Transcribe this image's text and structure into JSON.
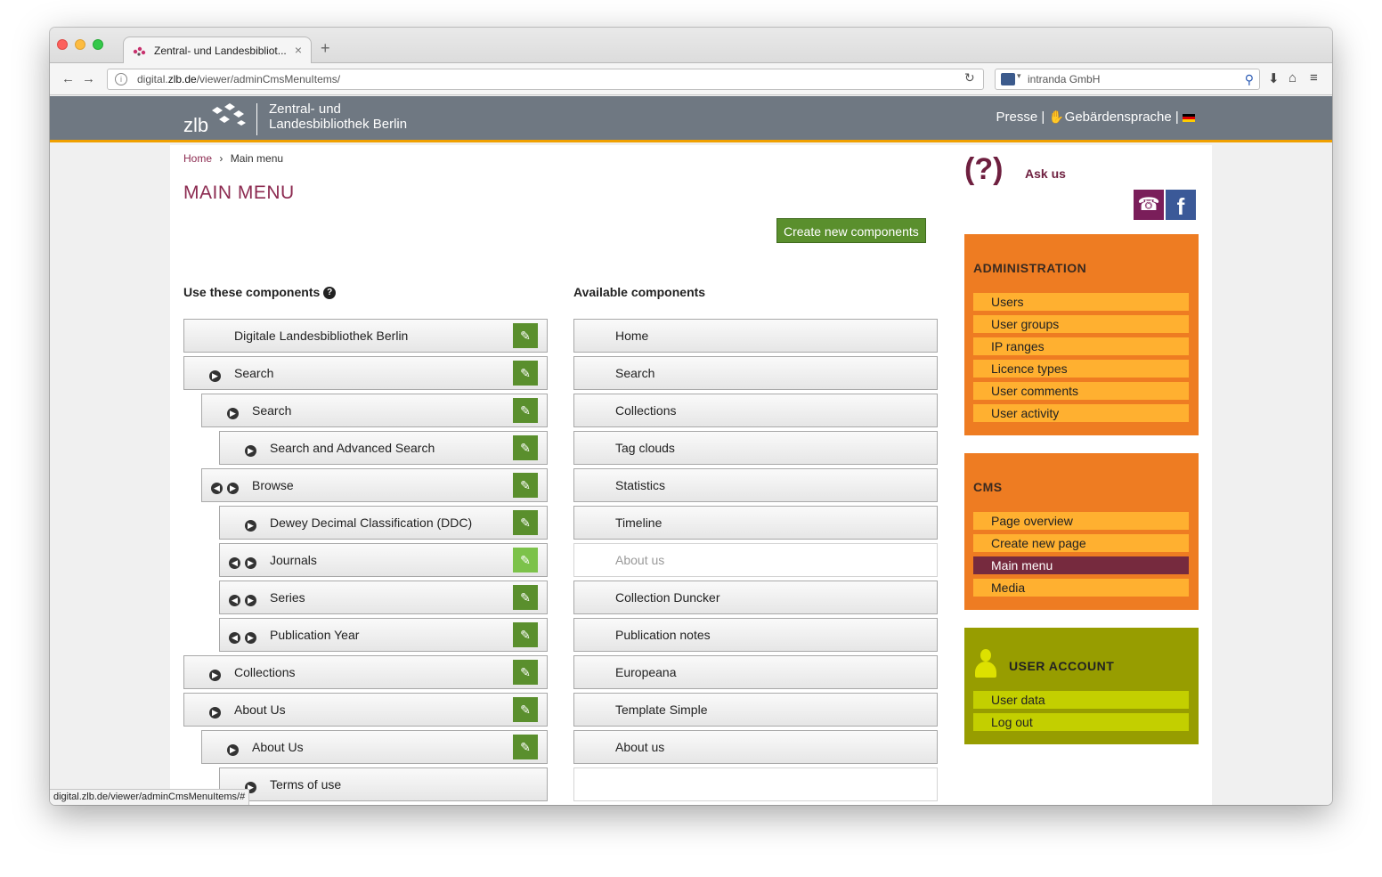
{
  "browser": {
    "tab_title": "Zentral- und Landesbibliot...",
    "new_tab": "+",
    "tab_close": "×",
    "url_prefix": "digital.",
    "url_domain": "zlb.de",
    "url_path": "/viewer/adminCmsMenuItems/",
    "search_text": "intranda GmbH",
    "status_url": "digital.zlb.de/viewer/adminCmsMenuItems/#",
    "icons": {
      "back": "←",
      "forward": "→",
      "reload": "↻",
      "download": "⬇",
      "home": "⌂",
      "menu": "≡",
      "search": "⚲"
    }
  },
  "site": {
    "logo_text": "zlb",
    "name_line1": "Zentral- und",
    "name_line2": "Landesbibliothek Berlin",
    "presse": "Presse",
    "sep": "|",
    "gebaerdensprache": "Gebärdensprache"
  },
  "breadcrumb": {
    "home": "Home",
    "sep": "›",
    "current": "Main menu"
  },
  "page_title": "MAIN MENU",
  "create_button": "Create new components",
  "used_title": "Use these components",
  "available_title": "Available components",
  "used_items": [
    {
      "label": "Digitale Landesbibliothek Berlin",
      "level": 0,
      "controls": 0,
      "edit_highlight": false
    },
    {
      "label": "Search",
      "level": 0,
      "controls": 1,
      "edit_highlight": false
    },
    {
      "label": "Search",
      "level": 1,
      "controls": 1,
      "edit_highlight": false
    },
    {
      "label": "Search and Advanced Search",
      "level": 2,
      "controls": 1,
      "edit_highlight": false
    },
    {
      "label": "Browse",
      "level": 1,
      "controls": 2,
      "edit_highlight": false
    },
    {
      "label": "Dewey Decimal Classification (DDC)",
      "level": 2,
      "controls": 1,
      "edit_highlight": false
    },
    {
      "label": "Journals",
      "level": 2,
      "controls": 2,
      "edit_highlight": true
    },
    {
      "label": "Series",
      "level": 2,
      "controls": 2,
      "edit_highlight": false
    },
    {
      "label": "Publication Year",
      "level": 2,
      "controls": 2,
      "edit_highlight": false
    },
    {
      "label": "Collections",
      "level": 0,
      "controls": 1,
      "edit_highlight": false
    },
    {
      "label": "About Us",
      "level": 0,
      "controls": 1,
      "edit_highlight": false
    },
    {
      "label": "About Us",
      "level": 1,
      "controls": 1,
      "edit_highlight": false
    },
    {
      "label": "Terms of use",
      "level": 2,
      "controls": 1,
      "edit_highlight": false,
      "no_edit": true
    }
  ],
  "available_items": [
    {
      "label": "Home"
    },
    {
      "label": "Search"
    },
    {
      "label": "Collections"
    },
    {
      "label": "Tag clouds"
    },
    {
      "label": "Statistics"
    },
    {
      "label": "Timeline"
    },
    {
      "label": "About us",
      "disabled": true
    },
    {
      "label": "Collection Duncker"
    },
    {
      "label": "Publication notes"
    },
    {
      "label": "Europeana"
    },
    {
      "label": "Template Simple"
    },
    {
      "label": "About us"
    },
    {
      "label": "",
      "disabled": true
    }
  ],
  "ask": {
    "icon": "(?)",
    "label": "Ask us"
  },
  "administration": {
    "title": "ADMINISTRATION",
    "links": [
      "Users",
      "User groups",
      "IP ranges",
      "Licence types",
      "User comments",
      "User activity"
    ]
  },
  "cms": {
    "title": "CMS",
    "links": [
      "Page overview",
      "Create new page",
      "Main menu",
      "Media"
    ],
    "active": "Main menu"
  },
  "user_account": {
    "title": "USER ACCOUNT",
    "links": [
      "User data",
      "Log out"
    ]
  },
  "colors": {
    "header": "#6f7882",
    "accent": "#8c2a50",
    "admin_panel": "#ee7c22",
    "user_panel": "#979d00",
    "edit_button": "#5a8f2d"
  }
}
